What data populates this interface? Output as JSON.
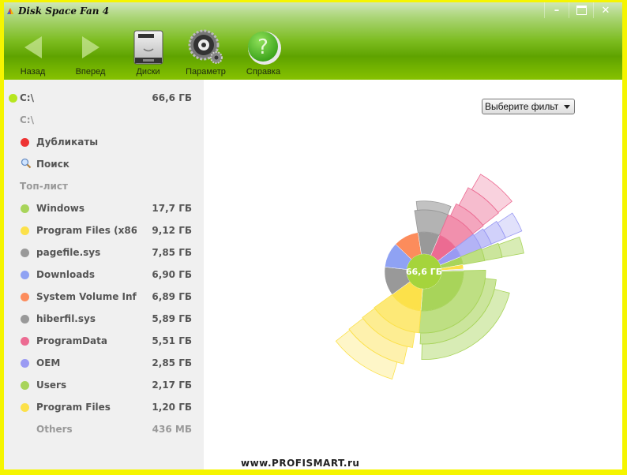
{
  "window": {
    "title": "Disk Space Fan 4",
    "controls": [
      "minimize",
      "maximize",
      "close"
    ]
  },
  "toolbar": {
    "items": [
      {
        "label": "Назад",
        "icon": "back-arrow-icon"
      },
      {
        "label": "Вперед",
        "icon": "forward-arrow-icon"
      },
      {
        "label": "Диски",
        "icon": "hard-drive-icon"
      },
      {
        "label": "Параметр",
        "icon": "gear-icon"
      },
      {
        "label": "Справка",
        "icon": "help-icon"
      }
    ]
  },
  "sidebar": {
    "drive": {
      "label": "C:\\",
      "size": "66,6 ГБ",
      "color": "#b6e61f"
    },
    "path": "C:\\",
    "duplicates": {
      "label": "Дубликаты",
      "color": "#ee3333"
    },
    "search": {
      "label": "Поиск"
    },
    "toplist_header": "Топ-лист",
    "items": [
      {
        "name": "Windows",
        "size": "17,7 ГБ",
        "color": "#a8d45a"
      },
      {
        "name": "Program Files (x86...",
        "size": "9,12 ГБ",
        "color": "#fce14a"
      },
      {
        "name": "pagefile.sys",
        "size": "7,85 ГБ",
        "color": "#999999"
      },
      {
        "name": "Downloads",
        "size": "6,90 ГБ",
        "color": "#8fa2f3"
      },
      {
        "name": "System Volume Info...",
        "size": "6,89 ГБ",
        "color": "#fc8c5c"
      },
      {
        "name": "hiberfil.sys",
        "size": "5,89 ГБ",
        "color": "#999999"
      },
      {
        "name": "ProgramData",
        "size": "5,51 ГБ",
        "color": "#ec6b92"
      },
      {
        "name": "OEM",
        "size": "2,85 ГБ",
        "color": "#9a9af3"
      },
      {
        "name": "Users",
        "size": "2,17 ГБ",
        "color": "#a8d45a"
      },
      {
        "name": "Program Files",
        "size": "1,20 ГБ",
        "color": "#fce14a"
      }
    ],
    "others": {
      "name": "Others",
      "size": "436 МБ"
    }
  },
  "filter": {
    "selected": "Выберите фильт"
  },
  "chart_data": {
    "type": "sunburst",
    "center_label": "66,6 ГБ",
    "total_gb": 66.6,
    "segments": [
      {
        "name": "Windows",
        "value_gb": 17.7,
        "color": "#a8d45a"
      },
      {
        "name": "Program Files (x86...",
        "value_gb": 9.12,
        "color": "#fce14a"
      },
      {
        "name": "pagefile.sys",
        "value_gb": 7.85,
        "color": "#999999"
      },
      {
        "name": "Downloads",
        "value_gb": 6.9,
        "color": "#8fa2f3"
      },
      {
        "name": "System Volume Info...",
        "value_gb": 6.89,
        "color": "#fc8c5c"
      },
      {
        "name": "hiberfil.sys",
        "value_gb": 5.89,
        "color": "#999999"
      },
      {
        "name": "ProgramData",
        "value_gb": 5.51,
        "color": "#ec6b92"
      },
      {
        "name": "OEM",
        "value_gb": 2.85,
        "color": "#9a9af3"
      },
      {
        "name": "Users",
        "value_gb": 2.17,
        "color": "#a8d45a"
      },
      {
        "name": "Program Files",
        "value_gb": 1.2,
        "color": "#fce14a"
      },
      {
        "name": "Others",
        "value_gb": 0.436,
        "color": "#dddddd"
      }
    ]
  },
  "watermark": "www.PROFISMART.ru"
}
